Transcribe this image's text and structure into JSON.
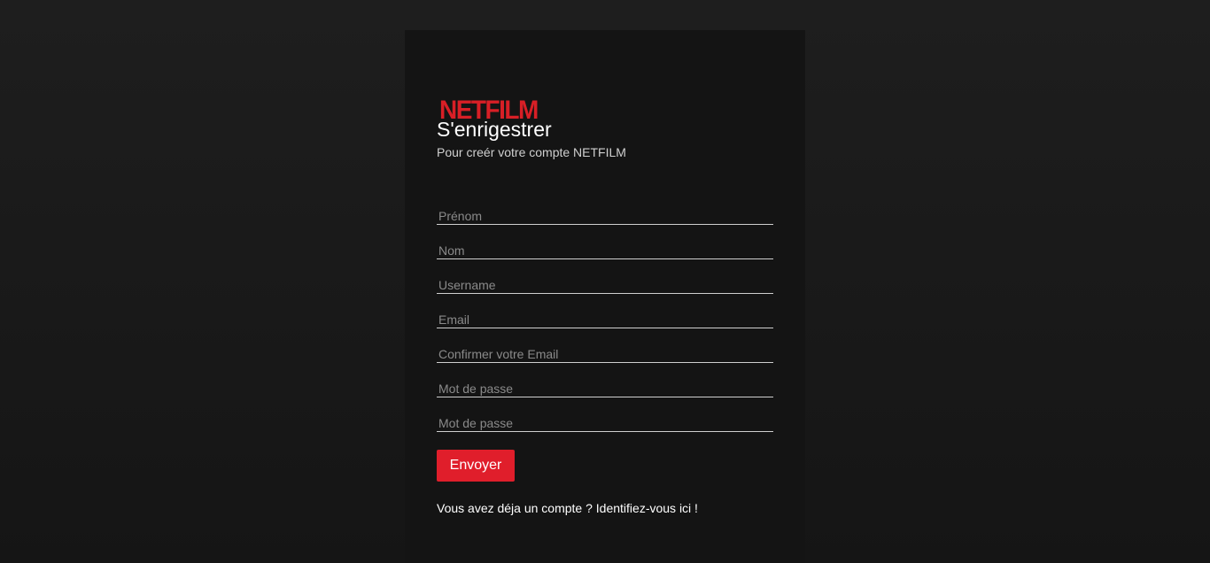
{
  "brand": {
    "logo_text": "NETFILM",
    "accent_color": "#d81f26"
  },
  "header": {
    "title": "S'enrigestrer",
    "subtitle": "Pour creér votre compte NETFILM"
  },
  "form": {
    "fields": [
      {
        "placeholder": "Prénom",
        "value": ""
      },
      {
        "placeholder": "Nom",
        "value": ""
      },
      {
        "placeholder": "Username",
        "value": ""
      },
      {
        "placeholder": "Email",
        "value": ""
      },
      {
        "placeholder": "Confirmer votre Email",
        "value": ""
      },
      {
        "placeholder": "Mot de passe",
        "value": ""
      },
      {
        "placeholder": "Mot de passe",
        "value": ""
      }
    ],
    "submit_label": "Envoyer",
    "submit_color": "#e01e2b"
  },
  "footer": {
    "signin_text": "Vous avez déja un compte ? Identifiez-vous ici !"
  }
}
